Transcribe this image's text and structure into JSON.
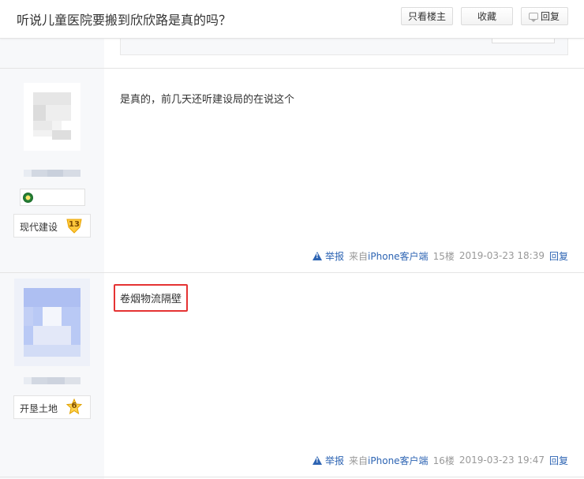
{
  "header": {
    "title": "听说儿童医院要搬到欣欣路是真的吗？",
    "only_op_label": "只看楼主",
    "favorite_label": "收藏",
    "reply_label": "回复"
  },
  "posts": [
    {
      "content": "是真的，前几天还听建设局的在说这个",
      "level_name": "现代建设",
      "level": "13",
      "report_label": "举报",
      "from_label": "来自",
      "client": "iPhone客户端",
      "floor": "15楼",
      "time": "2019-03-23 18:39",
      "reply_label": "回复"
    },
    {
      "content": "卷烟物流隔壁",
      "level_name": "开垦土地",
      "level": "6",
      "report_label": "举报",
      "from_label": "来自",
      "client": "iPhone客户端",
      "floor": "16楼",
      "time": "2019-03-23 19:47",
      "reply_label": "回复"
    }
  ],
  "colors": {
    "link": "#2d64b3",
    "highlight_border": "#e53333"
  }
}
